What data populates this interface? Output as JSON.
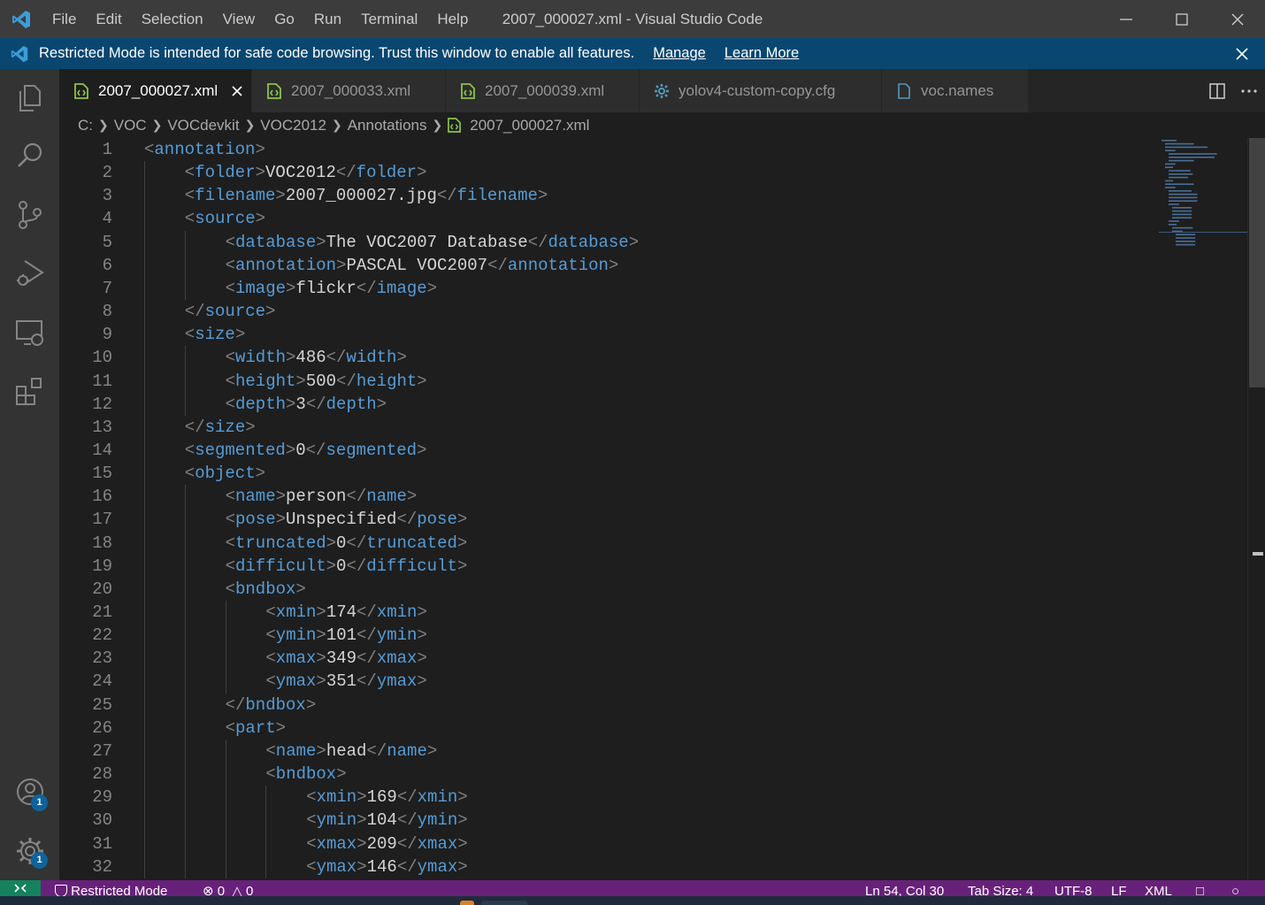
{
  "titlebar": {
    "menu": [
      "File",
      "Edit",
      "Selection",
      "View",
      "Go",
      "Run",
      "Terminal",
      "Help"
    ],
    "title": "2007_000027.xml - Visual Studio Code"
  },
  "banner": {
    "message": "Restricted Mode is intended for safe code browsing. Trust this window to enable all features.",
    "manage": "Manage",
    "learn_more": "Learn More"
  },
  "activity_bar": {
    "icons": [
      "explorer-icon",
      "search-icon",
      "source-control-icon",
      "run-debug-icon",
      "remote-explorer-icon",
      "extensions-icon"
    ],
    "accounts_badge": "1",
    "manage_badge": "1"
  },
  "tabs": [
    {
      "label": "2007_000027.xml",
      "icon": "xml-file-icon",
      "active": true
    },
    {
      "label": "2007_000033.xml",
      "icon": "xml-file-icon",
      "active": false
    },
    {
      "label": "2007_000039.xml",
      "icon": "xml-file-icon",
      "active": false
    },
    {
      "label": "yolov4-custom-copy.cfg",
      "icon": "gear-file-icon",
      "active": false
    },
    {
      "label": "voc.names",
      "icon": "file-icon",
      "active": false
    }
  ],
  "breadcrumb": [
    "C:",
    "VOC",
    "VOCdevkit",
    "VOC2012",
    "Annotations",
    "2007_000027.xml"
  ],
  "editor": {
    "lines": [
      {
        "n": "1",
        "indent": 0,
        "tag": "annotation",
        "kind": "open"
      },
      {
        "n": "2",
        "indent": 1,
        "tag": "folder",
        "kind": "value",
        "value": "VOC2012"
      },
      {
        "n": "3",
        "indent": 1,
        "tag": "filename",
        "kind": "value",
        "value": "2007_000027.jpg"
      },
      {
        "n": "4",
        "indent": 1,
        "tag": "source",
        "kind": "open"
      },
      {
        "n": "5",
        "indent": 2,
        "tag": "database",
        "kind": "value",
        "value": "The VOC2007 Database"
      },
      {
        "n": "6",
        "indent": 2,
        "tag": "annotation",
        "kind": "value",
        "value": "PASCAL VOC2007"
      },
      {
        "n": "7",
        "indent": 2,
        "tag": "image",
        "kind": "value",
        "value": "flickr"
      },
      {
        "n": "8",
        "indent": 1,
        "tag": "source",
        "kind": "close"
      },
      {
        "n": "9",
        "indent": 1,
        "tag": "size",
        "kind": "open"
      },
      {
        "n": "10",
        "indent": 2,
        "tag": "width",
        "kind": "value",
        "value": "486"
      },
      {
        "n": "11",
        "indent": 2,
        "tag": "height",
        "kind": "value",
        "value": "500"
      },
      {
        "n": "12",
        "indent": 2,
        "tag": "depth",
        "kind": "value",
        "value": "3"
      },
      {
        "n": "13",
        "indent": 1,
        "tag": "size",
        "kind": "close"
      },
      {
        "n": "14",
        "indent": 1,
        "tag": "segmented",
        "kind": "value",
        "value": "0"
      },
      {
        "n": "15",
        "indent": 1,
        "tag": "object",
        "kind": "open"
      },
      {
        "n": "16",
        "indent": 2,
        "tag": "name",
        "kind": "value",
        "value": "person"
      },
      {
        "n": "17",
        "indent": 2,
        "tag": "pose",
        "kind": "value",
        "value": "Unspecified"
      },
      {
        "n": "18",
        "indent": 2,
        "tag": "truncated",
        "kind": "value",
        "value": "0"
      },
      {
        "n": "19",
        "indent": 2,
        "tag": "difficult",
        "kind": "value",
        "value": "0"
      },
      {
        "n": "20",
        "indent": 2,
        "tag": "bndbox",
        "kind": "open"
      },
      {
        "n": "21",
        "indent": 3,
        "tag": "xmin",
        "kind": "value",
        "value": "174"
      },
      {
        "n": "22",
        "indent": 3,
        "tag": "ymin",
        "kind": "value",
        "value": "101"
      },
      {
        "n": "23",
        "indent": 3,
        "tag": "xmax",
        "kind": "value",
        "value": "349"
      },
      {
        "n": "24",
        "indent": 3,
        "tag": "ymax",
        "kind": "value",
        "value": "351"
      },
      {
        "n": "25",
        "indent": 2,
        "tag": "bndbox",
        "kind": "close"
      },
      {
        "n": "26",
        "indent": 2,
        "tag": "part",
        "kind": "open"
      },
      {
        "n": "27",
        "indent": 3,
        "tag": "name",
        "kind": "value",
        "value": "head"
      },
      {
        "n": "28",
        "indent": 3,
        "tag": "bndbox",
        "kind": "open"
      },
      {
        "n": "29",
        "indent": 4,
        "tag": "xmin",
        "kind": "value",
        "value": "169"
      },
      {
        "n": "30",
        "indent": 4,
        "tag": "ymin",
        "kind": "value",
        "value": "104"
      },
      {
        "n": "31",
        "indent": 4,
        "tag": "xmax",
        "kind": "value",
        "value": "209"
      },
      {
        "n": "32",
        "indent": 4,
        "tag": "ymax",
        "kind": "value",
        "value": "146"
      }
    ]
  },
  "statusbar": {
    "restricted": "Restricted Mode",
    "errors": "0",
    "warnings": "0",
    "position": "Ln 54, Col 30",
    "tab_size": "Tab Size: 4",
    "encoding": "UTF-8",
    "eol": "LF",
    "language": "XML"
  },
  "colors": {
    "tag": "#569cd6",
    "bracket": "#808080",
    "text": "#d4d4d4",
    "status_bar": "#68217a",
    "banner": "#094771",
    "xml_icon": "#8bc34a"
  }
}
